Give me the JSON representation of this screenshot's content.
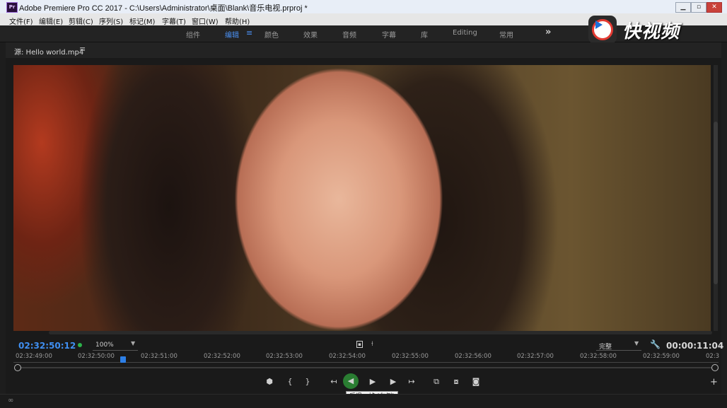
{
  "window": {
    "logo_text": "Pr",
    "title": "Adobe Premiere Pro CC 2017 - C:\\Users\\Administrator\\桌面\\Blank\\音乐电视.prproj *",
    "minimize": "▁",
    "maximize": "▫",
    "close": "✕"
  },
  "menu": [
    "文件(F)",
    "编辑(E)",
    "剪辑(C)",
    "序列(S)",
    "标记(M)",
    "字幕(T)",
    "窗口(W)",
    "帮助(H)"
  ],
  "workspaces": {
    "tabs": [
      "组件",
      "编辑",
      "颜色",
      "效果",
      "音频",
      "字幕",
      "库",
      "Editing",
      "常用"
    ],
    "active": "编辑",
    "menu_glyph": "≡",
    "more_glyph": "»"
  },
  "watermark": {
    "text": "快视频"
  },
  "source_panel": {
    "title": "源: Hello world.mp4",
    "menu_glyph": "≡",
    "current_timecode": "02:32:50:12",
    "zoom": "100%",
    "quality": "完整",
    "duration": "00:00:11:04",
    "ruler_ticks": [
      "02:32:49:00",
      "02:32:50:00",
      "02:32:51:00",
      "02:32:52:00",
      "02:32:53:00",
      "02:32:54:00",
      "02:32:55:00",
      "02:32:56:00",
      "02:32:57:00",
      "02:32:58:00",
      "02:32:59:00",
      "02:3"
    ],
    "tooltip": "后退一帧 (左侧)"
  },
  "controls": {
    "add_marker": "⬢",
    "mark_in": "{",
    "mark_out": "}",
    "go_to_in": "↤",
    "step_back": "◀",
    "play": "▶",
    "step_forward": "▶",
    "go_to_out": "↦",
    "insert": "⧉",
    "overwrite": "⧇",
    "export_frame": "◙",
    "add": "+"
  },
  "colors": {
    "accent": "#3f8ff2",
    "active_control": "#2a7d32"
  },
  "icons": {
    "wrench": "wrench-icon",
    "playhead": "playhead-icon"
  }
}
